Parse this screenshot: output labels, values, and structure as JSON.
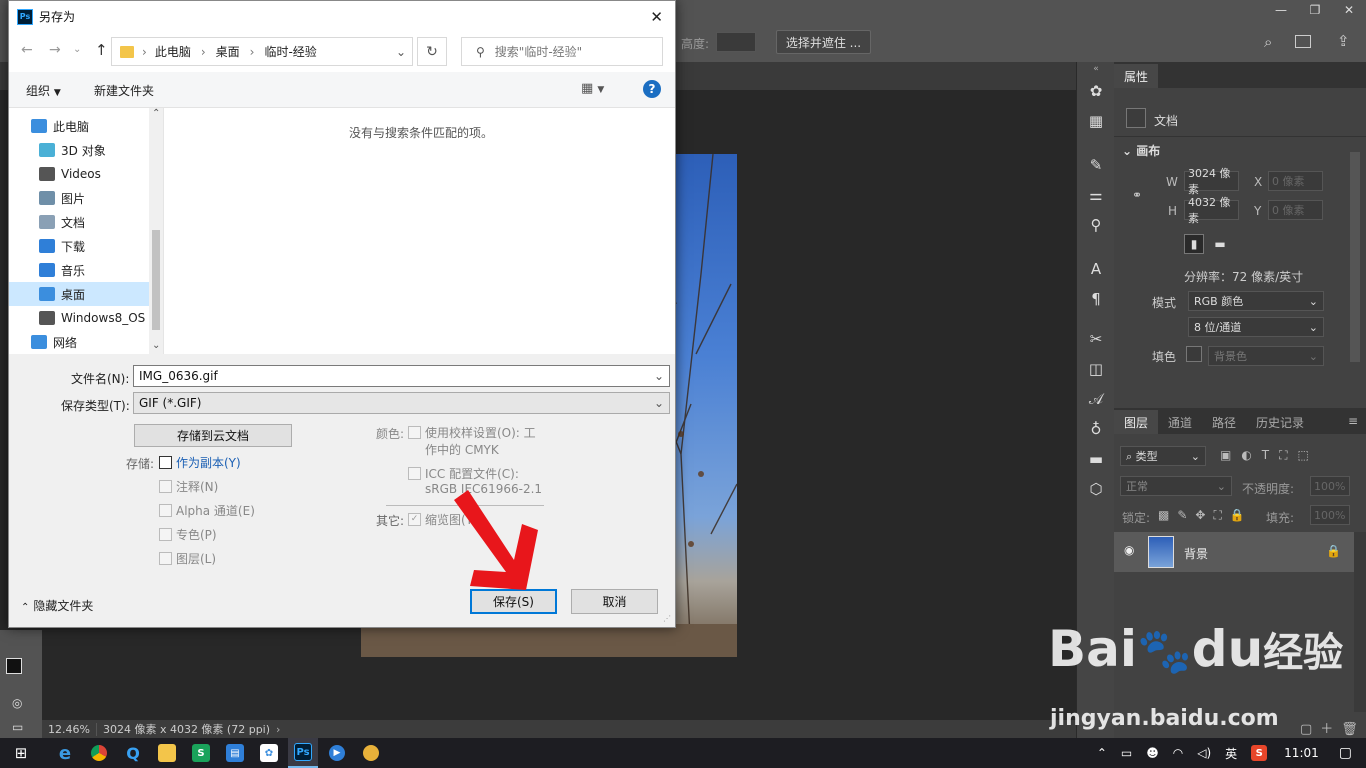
{
  "photoshop": {
    "options_bar": {
      "height_label": "高度:",
      "select_mask_button": "选择并遮住 ..."
    },
    "window_controls": [
      "—",
      "❐",
      "✕"
    ],
    "status": {
      "zoom": "12.46%",
      "doc_info": "3024 像素 x 4032 像素 (72 ppi)"
    },
    "properties_panel": {
      "tab": "属性",
      "doc_label": "文档",
      "canvas_section": "画布",
      "w_label": "W",
      "w_value": "3024 像素",
      "x_label": "X",
      "x_placeholder": "0 像素",
      "h_label": "H",
      "h_value": "4032 像素",
      "y_label": "Y",
      "y_placeholder": "0 像素",
      "resolution": "分辨率：72 像素/英寸",
      "mode_label": "模式",
      "mode_value": "RGB 颜色",
      "bits_value": "8 位/通道",
      "fill_label": "填色",
      "fill_value": "背景色"
    },
    "layers_panel": {
      "tabs": [
        "图层",
        "通道",
        "路径",
        "历史记录"
      ],
      "filter_label": "类型",
      "blend_mode": "正常",
      "opacity_label": "不透明度:",
      "opacity_value": "100%",
      "lock_label": "锁定:",
      "fill_label": "填充:",
      "fill_value": "100%",
      "layer_name": "背景"
    },
    "watermark": {
      "brand": "Bai",
      "brand2": "du",
      "cn": "经验",
      "url": "jingyan.baidu.com"
    }
  },
  "dialog": {
    "title": "另存为",
    "breadcrumb": [
      "此电脑",
      "桌面",
      "临时-经验"
    ],
    "search_placeholder": "搜索\"临时-经验\"",
    "organize": "组织",
    "new_folder": "新建文件夹",
    "nav_items": [
      {
        "label": "此电脑",
        "color": "#3b8ede"
      },
      {
        "label": "3D 对象",
        "color": "#4ab0d6"
      },
      {
        "label": "Videos",
        "color": "#555555"
      },
      {
        "label": "图片",
        "color": "#6f8fa8"
      },
      {
        "label": "文档",
        "color": "#8aa0b5"
      },
      {
        "label": "下载",
        "color": "#2f7fd8"
      },
      {
        "label": "音乐",
        "color": "#2f7fd8"
      },
      {
        "label": "桌面",
        "color": "#3b8ede"
      },
      {
        "label": "Windows8_OS",
        "color": "#555555"
      },
      {
        "label": "网络",
        "color": "#3b8ede"
      }
    ],
    "empty_message": "没有与搜索条件匹配的项。",
    "filename_label": "文件名(N):",
    "filename_value": "IMG_0636.gif",
    "filetype_label": "保存类型(T):",
    "filetype_value": "GIF (*.GIF)",
    "cloud_button": "存储到云文档",
    "save_label": "存储:",
    "as_copy": "作为副本(Y)",
    "notes": "注释(N)",
    "alpha": "Alpha 通道(E)",
    "spot": "专色(P)",
    "layers": "图层(L)",
    "color_label": "颜色:",
    "proof_setup": "使用校样设置(O):  工",
    "proof_setup2": "作中的 CMYK",
    "icc_profile": "ICC 配置文件(C):",
    "icc_value": "sRGB IEC61966-2.1",
    "other_label": "其它:",
    "thumbnail": "缩览图(T)",
    "hide_folders": "隐藏文件夹",
    "save_button": "保存(S)",
    "cancel_button": "取消"
  },
  "taskbar": {
    "ime": "英",
    "time": "11:01"
  }
}
